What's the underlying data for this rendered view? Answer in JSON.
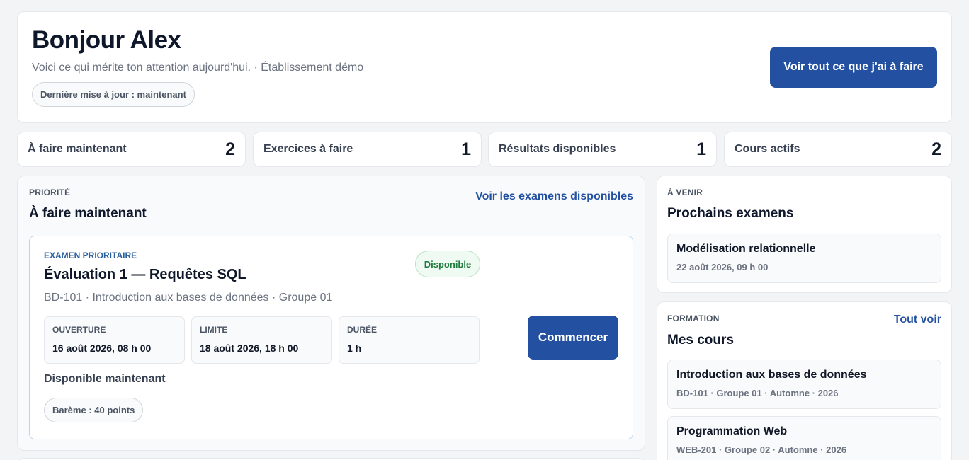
{
  "header": {
    "greeting": "Bonjour Alex",
    "subtitle": "Voici ce qui mérite ton attention aujourd'hui. · Établissement démo",
    "last_update": "Dernière mise à jour : maintenant",
    "cta": "Voir tout ce que j'ai à faire"
  },
  "stats": [
    {
      "label": "À faire maintenant",
      "value": "2"
    },
    {
      "label": "Exercices à faire",
      "value": "1"
    },
    {
      "label": "Résultats disponibles",
      "value": "1"
    },
    {
      "label": "Cours actifs",
      "value": "2"
    }
  ],
  "priority": {
    "eyebrow": "PRIORITÉ",
    "title": "À faire maintenant",
    "link": "Voir les examens disponibles",
    "exam": {
      "eyebrow": "EXAMEN PRIORITAIRE",
      "title": "Évaluation 1 — Requêtes SQL",
      "meta": "BD-101 · Introduction aux bases de données · Groupe 01",
      "badge": "Disponible",
      "opening_label": "OUVERTURE",
      "opening_value": "16 août 2026, 08 h 00",
      "deadline_label": "LIMITE",
      "deadline_value": "18 août 2026, 18 h 00",
      "duration_label": "DURÉE",
      "duration_value": "1 h",
      "start_button": "Commencer",
      "status": "Disponible maintenant",
      "points": "Barème : 40 points"
    }
  },
  "upcoming": {
    "eyebrow": "À VENIR",
    "title": "Prochains examens",
    "items": [
      {
        "title": "Modélisation relationnelle",
        "date": "22 août 2026, 09 h 00"
      }
    ]
  },
  "courses": {
    "eyebrow": "FORMATION",
    "title": "Mes cours",
    "link": "Tout voir",
    "items": [
      {
        "title": "Introduction aux bases de données",
        "meta": "BD-101 · Groupe 01 · Automne · 2026"
      },
      {
        "title": "Programmation Web",
        "meta": "WEB-201 · Groupe 02 · Automne · 2026"
      }
    ]
  },
  "colors": {
    "primary": "#2350a0",
    "success": "#1f7a3d",
    "background": "#f3f4f6"
  }
}
